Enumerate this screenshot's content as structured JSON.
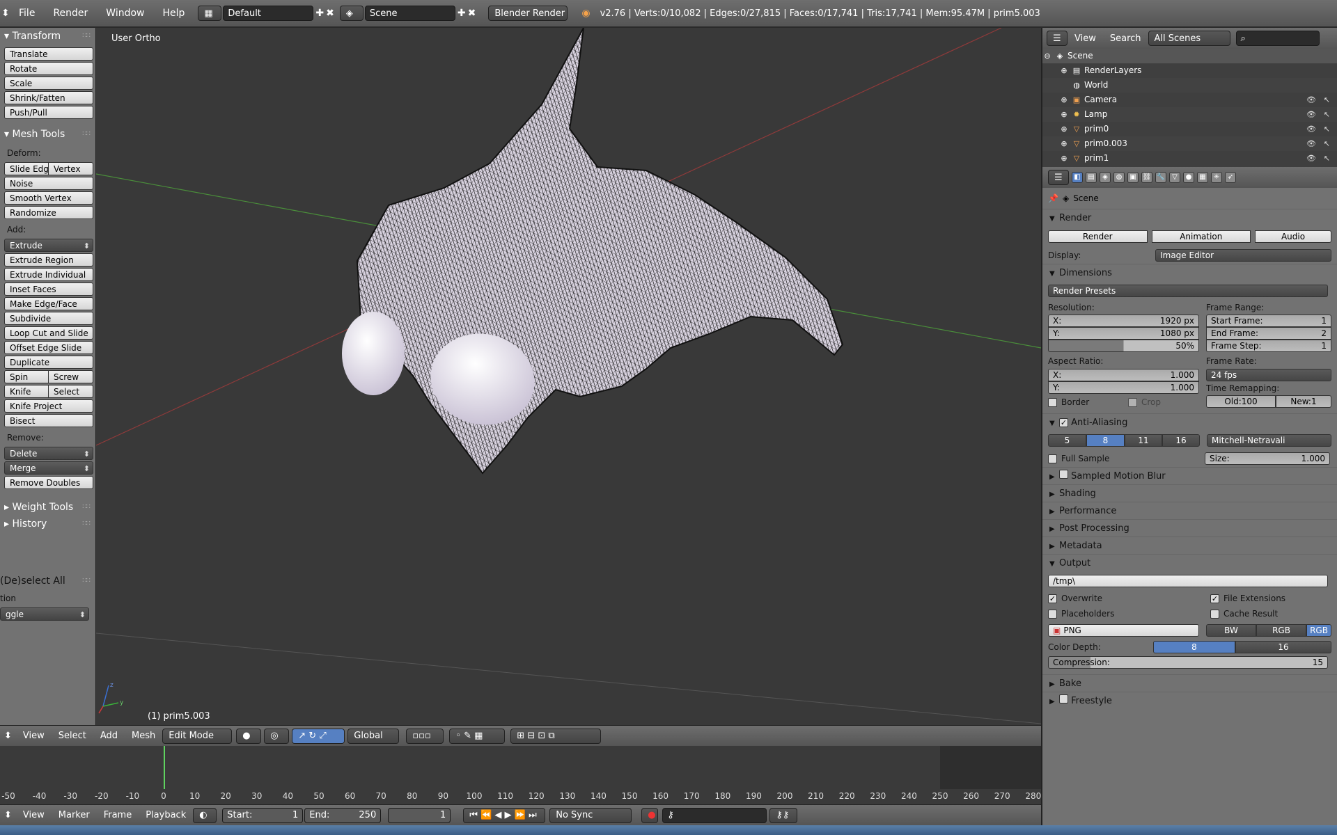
{
  "topbar": {
    "menus": [
      "File",
      "Render",
      "Window",
      "Help"
    ],
    "layout": "Default",
    "scene": "Scene",
    "engine": "Blender Render",
    "stats": "v2.76 | Verts:0/10,082 | Edges:0/27,815 | Faces:0/17,741 | Tris:17,741 | Mem:95.47M | prim5.003"
  },
  "toolshelf": {
    "transform": {
      "title": "Transform",
      "items": [
        "Translate",
        "Rotate",
        "Scale",
        "Shrink/Fatten",
        "Push/Pull"
      ]
    },
    "meshtools": {
      "title": "Mesh Tools",
      "deform_label": "Deform:",
      "slide_edge": "Slide Edge",
      "vertex": "Vertex",
      "noise": "Noise",
      "smooth_vertex": "Smooth Vertex",
      "randomize": "Randomize",
      "add_label": "Add:",
      "extrude": "Extrude",
      "extrude_region": "Extrude Region",
      "extrude_individual": "Extrude Individual",
      "inset_faces": "Inset Faces",
      "make_edge_face": "Make Edge/Face",
      "subdivide": "Subdivide",
      "loop_cut": "Loop Cut and Slide",
      "offset_edge": "Offset Edge Slide",
      "duplicate": "Duplicate",
      "spin": "Spin",
      "screw": "Screw",
      "knife": "Knife",
      "select": "Select",
      "knife_project": "Knife Project",
      "bisect": "Bisect",
      "remove_label": "Remove:",
      "delete": "Delete",
      "merge": "Merge",
      "remove_doubles": "Remove Doubles"
    },
    "weight_tools": "Weight Tools",
    "history": "History",
    "operator": {
      "title": "(De)select All",
      "action_label": "tion",
      "action_value": "ggle"
    }
  },
  "viewport": {
    "label": "User Ortho",
    "object": "(1) prim5.003"
  },
  "header3d": {
    "menus": [
      "View",
      "Select",
      "Add",
      "Mesh"
    ],
    "mode": "Edit Mode",
    "orientation": "Global"
  },
  "timeline": {
    "ticks": [
      "-50",
      "-40",
      "-30",
      "-20",
      "-10",
      "0",
      "10",
      "20",
      "30",
      "40",
      "50",
      "60",
      "70",
      "80",
      "90",
      "100",
      "110",
      "120",
      "130",
      "140",
      "150",
      "160",
      "170",
      "180",
      "190",
      "200",
      "210",
      "220",
      "230",
      "240",
      "250",
      "260",
      "270",
      "280"
    ],
    "current_frame": 1
  },
  "tlheader": {
    "menus": [
      "View",
      "Marker",
      "Frame",
      "Playback"
    ],
    "start_label": "Start:",
    "start": "1",
    "end_label": "End:",
    "end": "250",
    "frame": "1",
    "sync": "No Sync"
  },
  "outliner": {
    "view": "View",
    "search": "Search",
    "filter": "All Scenes",
    "rows": [
      "Scene",
      "RenderLayers",
      "World",
      "Camera",
      "Lamp",
      "prim0",
      "prim0.003",
      "prim1"
    ]
  },
  "properties": {
    "context": "Scene",
    "render": {
      "title": "Render",
      "render_btn": "Render",
      "animation_btn": "Animation",
      "audio_btn": "Audio",
      "display_label": "Display:",
      "display_value": "Image Editor"
    },
    "dimensions": {
      "title": "Dimensions",
      "presets": "Render Presets",
      "resolution_label": "Resolution:",
      "res_x_label": "X:",
      "res_x": "1920 px",
      "res_y_label": "Y:",
      "res_y": "1080 px",
      "res_pct": "50%",
      "aspect_label": "Aspect Ratio:",
      "asp_x_label": "X:",
      "asp_x": "1.000",
      "asp_y_label": "Y:",
      "asp_y": "1.000",
      "border": "Border",
      "crop": "Crop",
      "frame_range_label": "Frame Range:",
      "start_frame": "Start Frame:",
      "start_frame_val": "1",
      "end_frame": "End Frame:",
      "end_frame_val": "2",
      "frame_step": "Frame Step:",
      "frame_step_val": "1",
      "frame_rate_label": "Frame Rate:",
      "frame_rate": "24 fps",
      "time_remap_label": "Time Remapping:",
      "old_label": "Old:",
      "old": "100",
      "new_label": "New:",
      "new": "1"
    },
    "antialiasing": {
      "title": "Anti-Aliasing",
      "samples": [
        "5",
        "8",
        "11",
        "16"
      ],
      "active": "8",
      "filter": "Mitchell-Netravali",
      "full_sample": "Full Sample",
      "size_label": "Size:",
      "size": "1.000"
    },
    "collapsed": [
      "Sampled Motion Blur",
      "Shading",
      "Performance",
      "Post Processing",
      "Metadata"
    ],
    "output": {
      "title": "Output",
      "path": "/tmp\\",
      "overwrite": "Overwrite",
      "file_ext": "File Extensions",
      "placeholders": "Placeholders",
      "cache_result": "Cache Result",
      "format": "PNG",
      "bw": "BW",
      "rgb": "RGB",
      "rgba": "RGB",
      "color_depth_label": "Color Depth:",
      "depth_8": "8",
      "depth_16": "16",
      "compression_label": "Compression:",
      "compression": "15"
    },
    "bake": "Bake",
    "freestyle": "Freestyle"
  },
  "colors": {
    "accent": "#5680c2",
    "panel": "#727272",
    "viewport": "#393939",
    "frame_marker": "#5fd35f"
  }
}
